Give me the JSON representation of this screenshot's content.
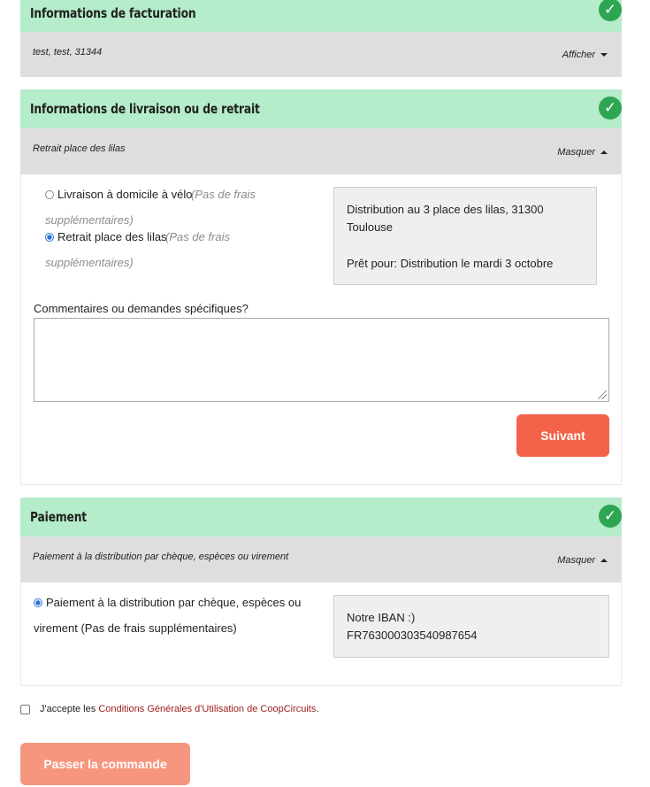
{
  "billing": {
    "title": "Informations de facturation",
    "summary": "test, test, 31344",
    "toggle": "Afficher"
  },
  "delivery": {
    "title": "Informations de livraison ou de retrait",
    "summary": "Retrait place des lilas",
    "toggle": "Masquer",
    "options": [
      {
        "label": "Livraison à domicile à vélo",
        "note1": "(Pas de frais",
        "note2": "supplémentaires)",
        "selected": false
      },
      {
        "label": "Retrait place des lilas",
        "note1": "(Pas de frais",
        "note2": "supplémentaires)",
        "selected": true
      }
    ],
    "info_line1": "Distribution au 3 place des lilas, 31300",
    "info_line2": "Toulouse",
    "info_line3": "Prêt pour: Distribution le mardi 3 octobre",
    "comments_label": "Commentaires ou demandes spécifiques?",
    "comments_value": "",
    "next_button": "Suivant"
  },
  "payment": {
    "title": "Paiement",
    "summary": "Paiement à la distribution par chèque, espèces ou virement",
    "toggle": "Masquer",
    "option_line1": "Paiement à la distribution par chèque, espèces ou",
    "option_line2": "virement (Pas de frais supplémentaires)",
    "iban_line1": "Notre IBAN :)",
    "iban_line2": "FR763000303540987654"
  },
  "terms": {
    "prefix": "J'accepte les ",
    "link": "Conditions Générales d'Utilisation de CoopCircuits",
    "suffix": "."
  },
  "order_button": "Passer la commande",
  "colors": {
    "header_bg": "#b5ecca",
    "check_green": "#2ea551",
    "primary_button": "#f2634a",
    "disabled_button": "#f6967f",
    "link": "#9b1b1b"
  },
  "icons": [
    "check-icon",
    "caret-down-icon",
    "caret-up-icon",
    "radio-icon",
    "checkbox-icon"
  ]
}
